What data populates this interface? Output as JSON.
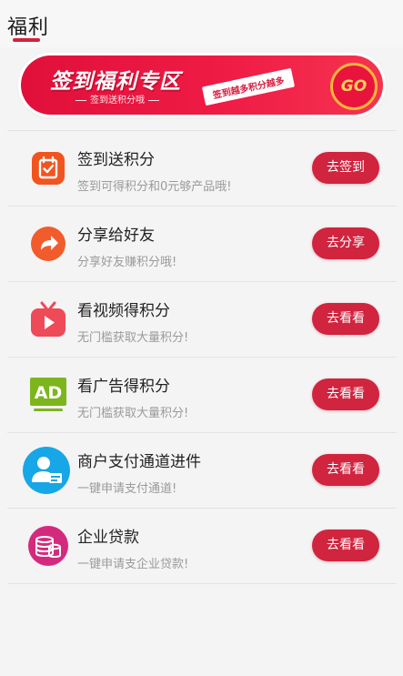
{
  "header": {
    "title": "福利"
  },
  "banner": {
    "title": "签到福利专区",
    "subtitle": "签到送积分哦",
    "tag": "签到越多积分越多",
    "go": "GO"
  },
  "items": [
    {
      "name": "签到送积分",
      "desc": "签到可得积分和0元够产品哦!",
      "button": "去签到",
      "icon": "checkin-icon",
      "color": "#f2541f"
    },
    {
      "name": "分享给好友",
      "desc": "分享好友赚积分哦!",
      "button": "去分享",
      "icon": "share-icon",
      "color": "#f25b2c"
    },
    {
      "name": "看视频得积分",
      "desc": "无门槛获取大量积分!",
      "button": "去看看",
      "icon": "video-icon",
      "color": "#ef4a57"
    },
    {
      "name": "看广告得积分",
      "desc": "无门槛获取大量积分!",
      "button": "去看看",
      "icon": "ad-icon",
      "color": "#7db51d"
    },
    {
      "name": "商户支付通道进件",
      "desc": "一键申请支付通道!",
      "button": "去看看",
      "icon": "merchant-icon",
      "color": "#17a7e6"
    },
    {
      "name": "企业贷款",
      "desc": "一键申请支企业贷款!",
      "button": "去看看",
      "icon": "loan-icon",
      "color": "#d42a7e"
    }
  ]
}
